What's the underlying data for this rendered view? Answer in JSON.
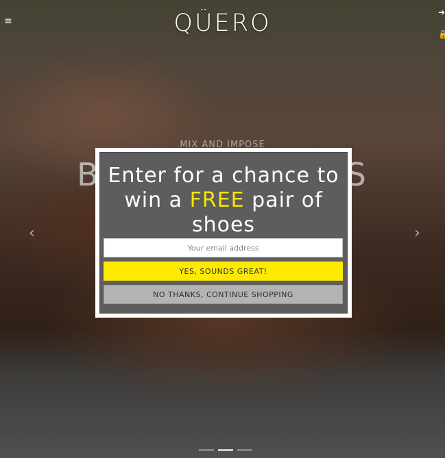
{
  "header": {
    "logo": "QÜERO",
    "menu_icon": "≡",
    "login_icon": "➜",
    "cart_icon": "🔒"
  },
  "hero": {
    "subtitle": "MIX AND IMPOSE",
    "title": "BESPOKE SHOES",
    "prev_arrow": "‹",
    "next_arrow": "›",
    "slides": 3,
    "active_slide": 2
  },
  "popup": {
    "headline_pre": "Enter for a chance to win a ",
    "headline_highlight": "FREE",
    "headline_post": " pair of shoes",
    "email_placeholder": "Your email address",
    "yes_label": "YES, SOUNDS GREAT!",
    "no_label": "NO THANKS, CONTINUE SHOPPING"
  },
  "colors": {
    "highlight": "#f6e500",
    "yes_button": "#fdea00",
    "no_button": "#b3b3b3",
    "popup_bg": "#585858"
  }
}
